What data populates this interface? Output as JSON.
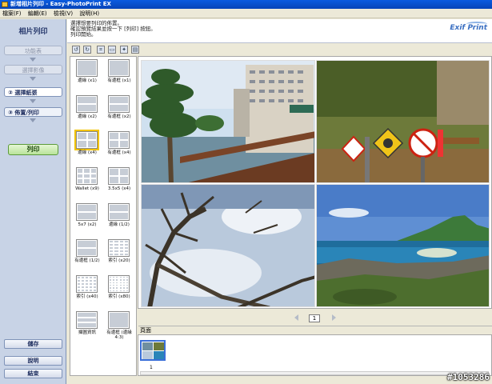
{
  "window": {
    "title": "新增相片列印 - Easy-PhotoPrint EX"
  },
  "menu": [
    {
      "label": "檔案(F)"
    },
    {
      "label": "編輯(E)"
    },
    {
      "label": "檢視(V)"
    },
    {
      "label": "說明(H)"
    }
  ],
  "sidebar": {
    "title": "相片列印",
    "steps": [
      {
        "label": "功能表",
        "state": "disabled"
      },
      {
        "label": "選擇影像",
        "state": "disabled"
      },
      {
        "label": "② 選擇紙張",
        "state": "done"
      },
      {
        "label": "③ 佈置/列印",
        "state": "active"
      }
    ],
    "print_label": "列印",
    "save_label": "儲存",
    "help_label": "說明",
    "exit_label": "結束"
  },
  "header": {
    "instructions": [
      "選擇想要列印的佈置。",
      "確認預覽結果並按一下 [列印] 按鈕。",
      "列印開始。"
    ],
    "logo_text": "Exif Print"
  },
  "toolbar": [
    {
      "icon": "rotate-left-icon"
    },
    {
      "icon": "rotate-right-icon"
    },
    {
      "icon": "crop-icon"
    },
    {
      "icon": "frame-icon"
    },
    {
      "icon": "correct-image-icon"
    },
    {
      "icon": "date-print-icon"
    }
  ],
  "layouts": [
    {
      "label": "邊緣 (x1)",
      "cells": 1
    },
    {
      "label": "有邊框 (x1)",
      "cells": 1
    },
    {
      "label": "邊緣 (x2)",
      "cells": 2
    },
    {
      "label": "有邊框 (x2)",
      "cells": 2
    },
    {
      "label": "邊緣 (x4)",
      "cells": 4,
      "selected": true
    },
    {
      "label": "有邊框 (x4)",
      "cells": 4
    },
    {
      "label": "Wallet (x9)",
      "cells": 9
    },
    {
      "label": "3.5x5 (x4)",
      "cells": 4
    },
    {
      "label": "5x7 (x2)",
      "cells": 2
    },
    {
      "label": "邊緣 (1/2)",
      "cells": 2
    },
    {
      "label": "有邊框 (1/2)",
      "cells": 2
    },
    {
      "label": "索引 (x20)",
      "cells": 20
    },
    {
      "label": "索引 (x40)",
      "cells": 40
    },
    {
      "label": "索引 (x80)",
      "cells": 80
    },
    {
      "label": "擷圖資訊",
      "cells": 3
    },
    {
      "label": "有邊框 (邊緣 4:3)",
      "cells": 1
    }
  ],
  "preview": {
    "photos": [
      {
        "subject": "hotel-by-sea"
      },
      {
        "subject": "warning-signs"
      },
      {
        "subject": "dead-tree"
      },
      {
        "subject": "coastline"
      }
    ]
  },
  "pager": {
    "current_page": "1"
  },
  "pages_panel": {
    "label": "頁面",
    "thumbs": [
      {
        "number": "1"
      }
    ]
  },
  "watermark": "#1053286",
  "colors": {
    "titlebar": "#0a5be0",
    "sidebar_bg": "#c8d3e6",
    "selected_outline": "#f2c300",
    "print_button": "#b9e39a"
  }
}
